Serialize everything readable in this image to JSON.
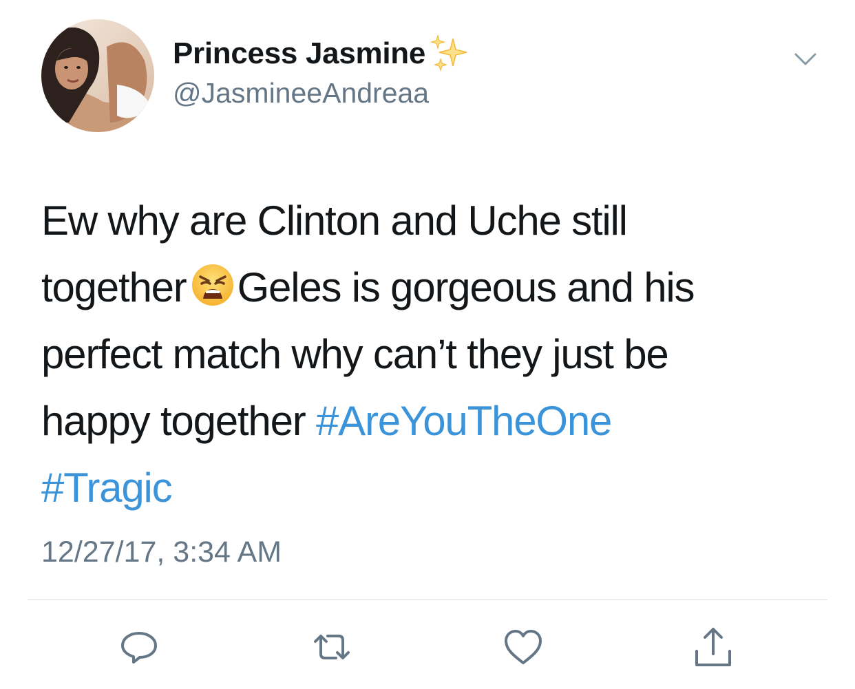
{
  "tweet": {
    "author": {
      "display_name": "Princess Jasmine",
      "name_emoji": "sparkles-icon",
      "handle": "@JasmineeAndreaa"
    },
    "body_lines": [
      {
        "text": "Ew why are Clinton and Uche still"
      },
      {
        "text_before_emoji": "together",
        "emoji": "weary-face-emoji",
        "text_after_emoji": "Geles is gorgeous and his"
      },
      {
        "text": "perfect match why can’t they just be"
      },
      {
        "text": "happy together",
        "hashtag": "#AreYouTheOne"
      },
      {
        "hashtag": "#Tragic"
      }
    ],
    "timestamp": "12/27/17, 3:34 AM"
  },
  "actions": [
    {
      "name": "reply",
      "icon": "reply-icon"
    },
    {
      "name": "retweet",
      "icon": "retweet-icon"
    },
    {
      "name": "like",
      "icon": "heart-icon"
    },
    {
      "name": "share",
      "icon": "share-icon"
    }
  ],
  "colors": {
    "text": "#14171a",
    "secondary": "#657786",
    "link": "#3b94d9",
    "icon": "#657786",
    "divider": "#d6dce0"
  }
}
